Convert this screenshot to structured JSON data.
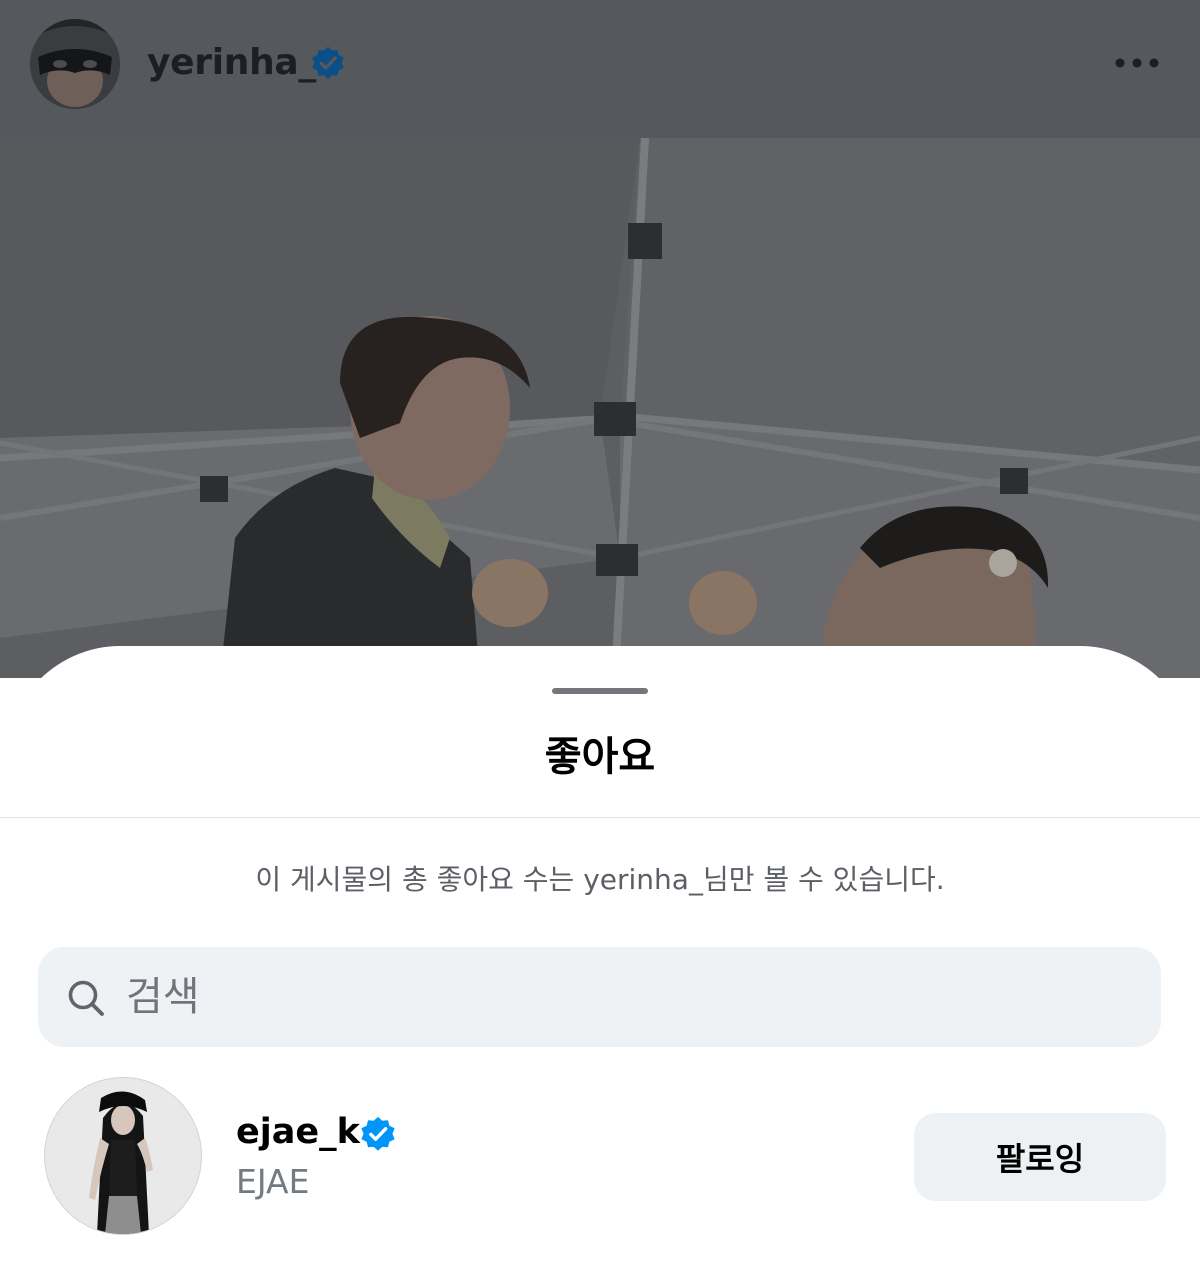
{
  "post_header": {
    "username": "yerinha_",
    "verified_icon": "verified-badge-icon",
    "more_icon": "more-horizontal-icon"
  },
  "likes_sheet": {
    "title": "좋아요",
    "privacy_note": "이 게시물의 총 좋아요 수는 yerinha_님만 볼 수 있습니다.",
    "search": {
      "placeholder": "검색",
      "icon": "search-icon"
    },
    "users": [
      {
        "username": "ejae_k",
        "verified": true,
        "full_name": "EJAE",
        "follow_button_label": "팔로잉"
      }
    ]
  },
  "colors": {
    "verified_blue": "#0095f6",
    "overlay_dim": "#55585c",
    "search_bg": "#eff2f5",
    "follow_button_bg": "#eef1f4"
  }
}
